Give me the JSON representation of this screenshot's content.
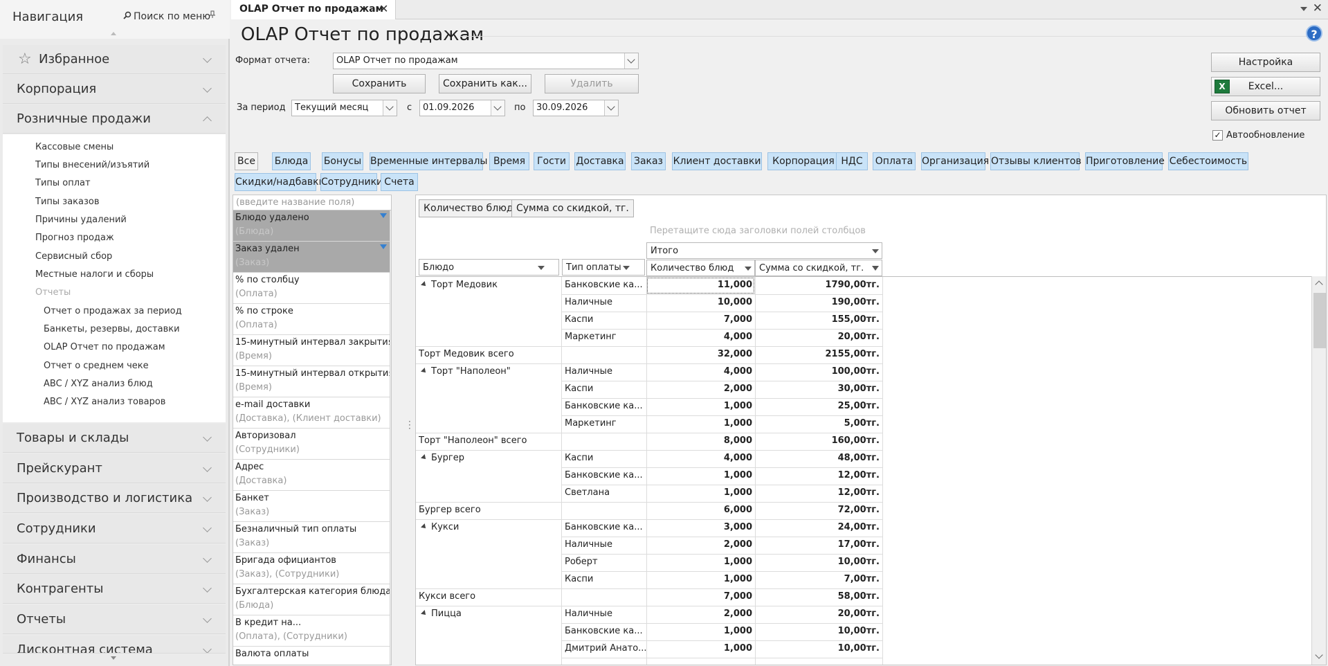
{
  "sidebar": {
    "title": "Навигация",
    "search_label": "Поиск по меню",
    "sections_top": [
      {
        "label": "Избранное"
      },
      {
        "label": "Корпорация"
      },
      {
        "label": "Розничные продажи"
      }
    ],
    "retail_items": [
      "Кассовые смены",
      "Типы внесений/изъятий",
      "Типы оплат",
      "Типы заказов",
      "Причины удалений",
      "Прогноз продаж",
      "Сервисный сбор",
      "Местные налоги и сборы"
    ],
    "reports_label": "Отчеты",
    "report_items": [
      "Отчет о продажах за период",
      "Банкеты, резервы, доставки",
      "OLAP Отчет по продажам",
      "Отчет о среднем чеке",
      "ABC / XYZ анализ блюд",
      "ABC / XYZ анализ товаров"
    ],
    "sections_bottom": [
      "Товары и склады",
      "Прейскурант",
      "Производство и логистика",
      "Сотрудники",
      "Финансы",
      "Контрагенты",
      "Отчеты",
      "Дисконтная система"
    ]
  },
  "tab": {
    "title": "OLAP Отчет по продажам",
    "close": "✕"
  },
  "page": {
    "title": "OLAP Отчет по продажам",
    "help": "?",
    "format_label": "Формат отчета:",
    "format_value": "OLAP Отчет по продажам",
    "save": "Сохранить",
    "save_as": "Сохранить как...",
    "delete": "Удалить",
    "period_label": "За период",
    "period_value": "Текущий месяц",
    "from_label": "с",
    "from_date": "01.09.2026",
    "to_label": "по",
    "to_date": "30.09.2026",
    "settings": "Настройка",
    "excel": "Excel...",
    "refresh": "Обновить отчет",
    "autoupdate": "Автообновление",
    "autoupdate_checked": true
  },
  "filters": [
    "Все",
    "Блюда",
    "Бонусы",
    "Временные интервалы",
    "Время",
    "Гости",
    "Доставка",
    "Заказ",
    "Клиент доставки",
    "Корпорация",
    "НДС",
    "Оплата",
    "Организация",
    "Отзывы клиентов",
    "Приготовление",
    "Себестоимость",
    "Скидки/надбавки",
    "Сотрудники",
    "Счета"
  ],
  "field_list": {
    "placeholder": "(введите название поля)",
    "items": [
      {
        "name": "Блюдо удалено",
        "group": "(Блюда)",
        "active": true
      },
      {
        "name": "Заказ удален",
        "group": "(Заказ)",
        "active": true
      },
      {
        "name": "% по столбцу",
        "group": "(Оплата)",
        "active": false
      },
      {
        "name": "% по строке",
        "group": "(Оплата)",
        "active": false
      },
      {
        "name": "15-минутный интервал закрытия",
        "group": "(Время)",
        "active": false
      },
      {
        "name": "15-минутный интервал открытия",
        "group": "(Время)",
        "active": false
      },
      {
        "name": "e-mail доставки",
        "group": "(Доставка), (Клиент доставки)",
        "active": false
      },
      {
        "name": "Авторизовал",
        "group": "(Сотрудники)",
        "active": false
      },
      {
        "name": "Адрес",
        "group": "(Доставка)",
        "active": false
      },
      {
        "name": "Банкет",
        "group": "(Заказ)",
        "active": false
      },
      {
        "name": "Безналичный тип оплаты",
        "group": "(Заказ)",
        "active": false
      },
      {
        "name": "Бригада официантов",
        "group": "(Заказ), (Сотрудники)",
        "active": false
      },
      {
        "name": "Бухгалтерская категория блюда",
        "group": "(Блюда)",
        "active": false
      },
      {
        "name": "В кредит на...",
        "group": "(Оплата), (Сотрудники)",
        "active": false
      },
      {
        "name": "Валюта оплаты",
        "group": "",
        "active": false
      }
    ]
  },
  "pivot": {
    "data_fields": [
      "Количество блюд",
      "Сумма со скидкой, тг."
    ],
    "drop_hint": "Перетащите сюда заголовки полей столбцов",
    "col_total": "Итого",
    "row_fields": [
      "Блюдо",
      "Тип оплаты"
    ],
    "measures": [
      "Количество блюд",
      "Сумма со скидкой, тг."
    ],
    "groups": [
      {
        "dish": "Торт Медовик",
        "rows": [
          {
            "pay": "Банковские ка...",
            "qty": "11,000",
            "sum": "1790,00тг."
          },
          {
            "pay": "Наличные",
            "qty": "10,000",
            "sum": "190,00тг."
          },
          {
            "pay": "Каспи",
            "qty": "7,000",
            "sum": "155,00тг."
          },
          {
            "pay": "Маркетинг",
            "qty": "4,000",
            "sum": "20,00тг."
          }
        ],
        "total_label": "Торт Медовик всего",
        "total_qty": "32,000",
        "total_sum": "2155,00тг."
      },
      {
        "dish": "Торт \"Наполеон\"",
        "rows": [
          {
            "pay": "Наличные",
            "qty": "4,000",
            "sum": "100,00тг."
          },
          {
            "pay": "Каспи",
            "qty": "2,000",
            "sum": "30,00тг."
          },
          {
            "pay": "Банковские ка...",
            "qty": "1,000",
            "sum": "25,00тг."
          },
          {
            "pay": "Маркетинг",
            "qty": "1,000",
            "sum": "5,00тг."
          }
        ],
        "total_label": "Торт \"Наполеон\" всего",
        "total_qty": "8,000",
        "total_sum": "160,00тг."
      },
      {
        "dish": "Бургер",
        "rows": [
          {
            "pay": "Каспи",
            "qty": "4,000",
            "sum": "48,00тг."
          },
          {
            "pay": "Банковские ка...",
            "qty": "1,000",
            "sum": "12,00тг."
          },
          {
            "pay": "Светлана",
            "qty": "1,000",
            "sum": "12,00тг."
          }
        ],
        "total_label": "Бургер всего",
        "total_qty": "6,000",
        "total_sum": "72,00тг."
      },
      {
        "dish": "Кукси",
        "rows": [
          {
            "pay": "Банковские ка...",
            "qty": "3,000",
            "sum": "24,00тг."
          },
          {
            "pay": "Наличные",
            "qty": "2,000",
            "sum": "17,00тг."
          },
          {
            "pay": "Роберт",
            "qty": "1,000",
            "sum": "10,00тг."
          },
          {
            "pay": "Каспи",
            "qty": "1,000",
            "sum": "7,00тг."
          }
        ],
        "total_label": "Кукси всего",
        "total_qty": "7,000",
        "total_sum": "58,00тг."
      },
      {
        "dish": "Пицца",
        "rows": [
          {
            "pay": "Наличные",
            "qty": "2,000",
            "sum": "20,00тг."
          },
          {
            "pay": "Банковские ка...",
            "qty": "1,000",
            "sum": "10,00тг."
          },
          {
            "pay": "Дмитрий Анато...",
            "qty": "1,000",
            "sum": "10,00тг."
          }
        ],
        "total_label": "",
        "total_qty": "",
        "total_sum": ""
      }
    ]
  }
}
